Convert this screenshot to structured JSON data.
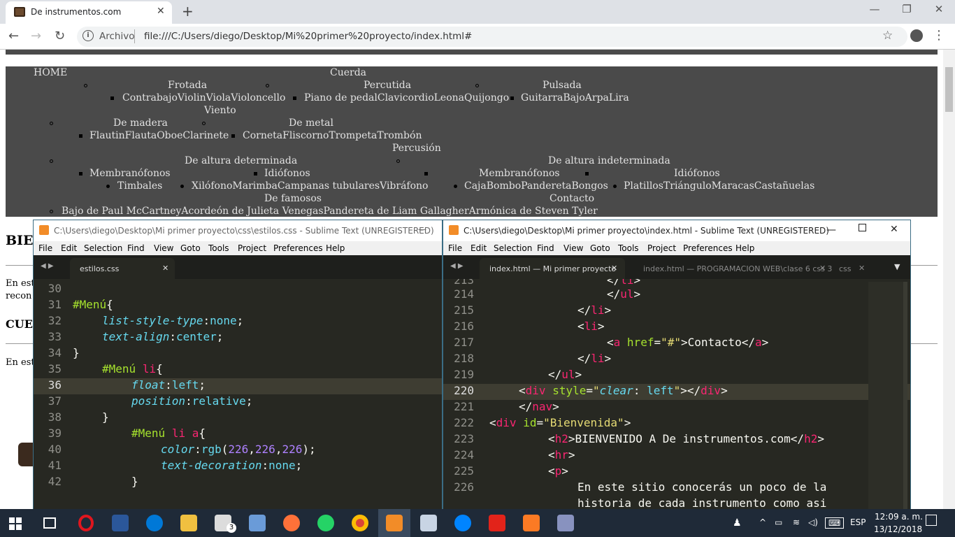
{
  "browser": {
    "tab_title": "De instrumentos.com",
    "address_label": "Archivo",
    "url": "file:///C:/Users/diego/Desktop/Mi%20primer%20proyecto/index.html#"
  },
  "nav": {
    "home": "HOME",
    "cuerda": "Cuerda",
    "frotada": "Frotada",
    "percutida": "Percutida",
    "pulsada": "Pulsada",
    "frotada_items": "ContrabajoViolinViolaVioloncello",
    "percutida_items": "Piano de pedalClavicordioLeonaQuijongo",
    "pulsada_items": "GuitarraBajoArpaLira",
    "viento": "Viento",
    "madera": "De madera",
    "metal": "De metal",
    "madera_items": "FlautinFlautaOboeClarinete",
    "metal_items": "CornetaFliscornoTrompetaTrombón",
    "percusion": "Percusión",
    "altura_det": "De altura determinada",
    "altura_indet": "De altura indeterminada",
    "membranofonos": "Membranófonos",
    "idiofonos": "Idiófonos",
    "membranofonos2": "Membranófonos",
    "idiofonos2": "Idiófonos",
    "timbales": "Timbales",
    "idio_det_items": "XilófonoMarimbaCampanas tubularesVibráfono",
    "membra_indet_items": "CajaBomboPanderetaBongos",
    "idio_indet_items": "PlatillosTriánguloMaracasCastañuelas",
    "famosos": "De famosos",
    "famosos_items": "Bajo de Paul McCartneyAcordeón de Julieta VenegasPandereta de Liam GallagherArmónica de Steven Tyler",
    "contacto": "Contacto"
  },
  "page": {
    "h_bie": "BIE",
    "p1a": "En est",
    "p1b": "recon",
    "h_cue": "CUE",
    "p2": "En est"
  },
  "sublime_left": {
    "title": "C:\\Users\\diego\\Desktop\\Mi primer proyecto\\css\\estilos.css - Sublime Text (UNREGISTERED)",
    "tab": "estilos.css",
    "min_icon": "—"
  },
  "sublime_right": {
    "title": "C:\\Users\\diego\\Desktop\\Mi primer proyecto\\index.html - Sublime Text (UNREGISTERED)",
    "tab1": "index.html — Mi primer proyecto",
    "tab2": "index.html — PROGRAMACION  WEB\\clase 6 css 3",
    "tab3": "css"
  },
  "menu": [
    "File",
    "Edit",
    "Selection",
    "Find",
    "View",
    "Goto",
    "Tools",
    "Project",
    "Preferences",
    "Help"
  ],
  "css_lines": [
    "30",
    "31",
    "32",
    "33",
    "34",
    "35",
    "36",
    "37",
    "38",
    "39",
    "40",
    "41",
    "42"
  ],
  "html_lines": [
    "213",
    "214",
    "215",
    "216",
    "217",
    "218",
    "219",
    "220",
    "221",
    "222",
    "223",
    "224",
    "225",
    "226",
    ""
  ],
  "html_text": {
    "l223": "BIENVENIDO A De instrumentos.com",
    "l226a": "En este sitio conocerás un poco de la",
    "l226b": "historia de cada instrumento como asi"
  },
  "tray": {
    "lang": "ESP",
    "time": "12:09 a. m.",
    "date": "13/12/2018",
    "mail_count": "3"
  }
}
